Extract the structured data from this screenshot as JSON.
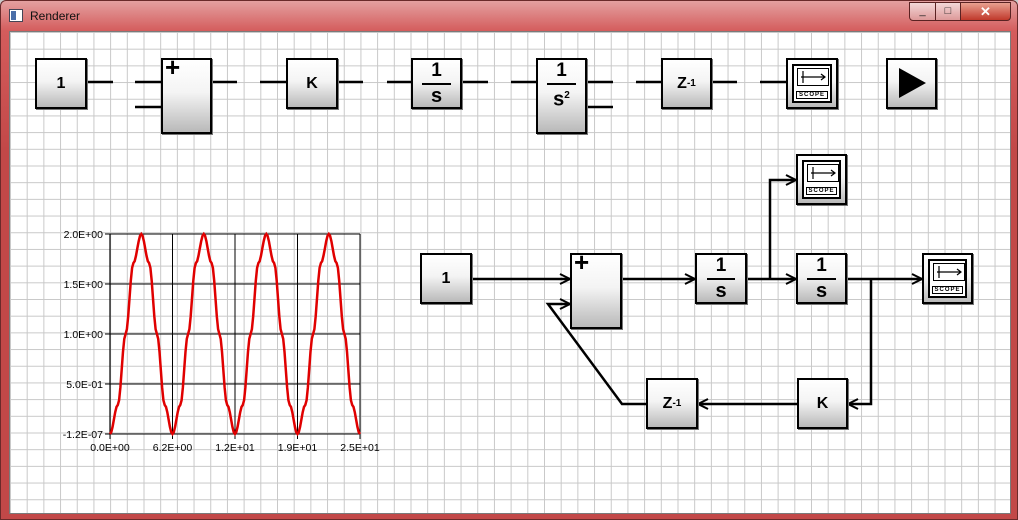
{
  "window": {
    "title": "Renderer",
    "min_label": "_",
    "max_label": "□",
    "close_label": "✕"
  },
  "palette": [
    {
      "id": "const",
      "label": "1"
    },
    {
      "id": "sum",
      "label": "+"
    },
    {
      "id": "gain",
      "label": "K"
    },
    {
      "id": "integ",
      "num": "1",
      "den": "s"
    },
    {
      "id": "integ2",
      "num": "1",
      "den": "s",
      "exp": "2"
    },
    {
      "id": "delay",
      "label": "Z",
      "exp": "-1"
    },
    {
      "id": "scope",
      "label": "SCOPE"
    },
    {
      "id": "run",
      "icon": "play-icon"
    }
  ],
  "diagram": {
    "const": {
      "label": "1"
    },
    "sum": {
      "label": "+"
    },
    "integ1": {
      "num": "1",
      "den": "s"
    },
    "integ2": {
      "num": "1",
      "den": "s"
    },
    "gain": {
      "label": "K"
    },
    "delay": {
      "label": "Z",
      "exp": "-1"
    },
    "scope_top": {
      "label": "SCOPE"
    },
    "scope_right": {
      "label": "SCOPE"
    }
  },
  "colors": {
    "trace": "#e00000",
    "grid": "#000000"
  },
  "chart_data": {
    "type": "line",
    "title": "",
    "xlabel": "",
    "ylabel": "",
    "xlim": [
      0,
      25
    ],
    "ylim": [
      -1.2e-07,
      2.0
    ],
    "x_ticks": [
      "0.0E+00",
      "6.2E+00",
      "1.2E+01",
      "1.9E+01",
      "2.5E+01"
    ],
    "y_ticks": [
      "2.0E+00",
      "1.5E+00",
      "1.0E+00",
      "5.0E-01",
      "-1.2E-07"
    ],
    "series": [
      {
        "color": "#e00000",
        "x": [
          0,
          0.78,
          1.56,
          2.34,
          3.13,
          3.91,
          4.69,
          5.47,
          6.25,
          7.03,
          7.81,
          8.59,
          9.38,
          10.16,
          10.94,
          11.72,
          12.5,
          13.28,
          14.06,
          14.84,
          15.63,
          16.41,
          17.19,
          17.97,
          18.75,
          19.53,
          20.31,
          21.09,
          21.88,
          22.66,
          23.44,
          24.22,
          25
        ],
        "y": [
          0,
          0.29,
          1.0,
          1.71,
          2.0,
          1.71,
          1.0,
          0.29,
          0,
          0.29,
          1.0,
          1.71,
          2.0,
          1.71,
          1.0,
          0.29,
          0,
          0.29,
          1.0,
          1.71,
          2.0,
          1.71,
          1.0,
          0.29,
          0,
          0.29,
          1.0,
          1.71,
          2.0,
          1.71,
          1.0,
          0.29,
          0
        ]
      }
    ]
  }
}
